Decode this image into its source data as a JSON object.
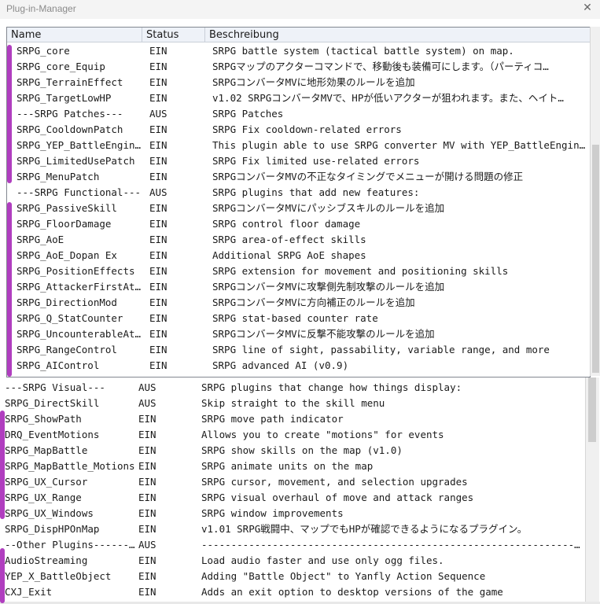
{
  "window": {
    "title": "Plug-in-Manager",
    "close_glyph": "✕"
  },
  "columns": {
    "name": "Name",
    "status": "Status",
    "description": "Beschreibung"
  },
  "accent_color": "#b03ebf",
  "rows_top": [
    {
      "name": "SRPG_core",
      "status": "EIN",
      "desc": "SRPG battle system (tactical battle system) on map."
    },
    {
      "name": "SRPG_core_Equip",
      "status": "EIN",
      "desc": "SRPGマップのアクターコマンドで、移動後も装備可にします。（パーティコ…"
    },
    {
      "name": "SRPG_TerrainEffect",
      "status": "EIN",
      "desc": "SRPGコンバータMVに地形効果のルールを追加"
    },
    {
      "name": "SRPG_TargetLowHP",
      "status": "EIN",
      "desc": "v1.02 SRPGコンバータMVで、HPが低いアクターが狙われます。また、ヘイト…"
    },
    {
      "name": "---SRPG Patches---",
      "status": "AUS",
      "desc": "SRPG Patches"
    },
    {
      "name": "SRPG_CooldownPatch",
      "status": "EIN",
      "desc": "SRPG Fix cooldown-related errors"
    },
    {
      "name": "SRPG_YEP_BattleEngine…",
      "status": "EIN",
      "desc": "This plugin able to use SRPG converter MV with YEP_BattleEngineCore.…"
    },
    {
      "name": "SRPG_LimitedUsePatch",
      "status": "EIN",
      "desc": "SRPG Fix limited use-related errors"
    },
    {
      "name": "SRPG_MenuPatch",
      "status": "EIN",
      "desc": "SRPGコンバータMVの不正なタイミングでメニューが開ける問題の修正"
    },
    {
      "name": "---SRPG Functional---",
      "status": "AUS",
      "desc": "SRPG plugins that add new features:"
    },
    {
      "name": "SRPG_PassiveSkill",
      "status": "EIN",
      "desc": "SRPGコンバータMVにパッシブスキルのルールを追加"
    },
    {
      "name": "SRPG_FloorDamage",
      "status": "EIN",
      "desc": "SRPG control floor damage"
    },
    {
      "name": "SRPG_AoE",
      "status": "EIN",
      "desc": "SRPG area-of-effect skills"
    },
    {
      "name": "SRPG_AoE_Dopan Ex",
      "status": "EIN",
      "desc": "Additional SRPG AoE shapes"
    },
    {
      "name": "SRPG_PositionEffects",
      "status": "EIN",
      "desc": "SRPG extension for movement and positioning skills"
    },
    {
      "name": "SRPG_AttackerFirstAtt…",
      "status": "EIN",
      "desc": "SRPGコンバータMVに攻撃側先制攻撃のルールを追加"
    },
    {
      "name": "SRPG_DirectionMod",
      "status": "EIN",
      "desc": "SRPGコンバータMVに方向補正のルールを追加"
    },
    {
      "name": "SRPG_Q_StatCounter",
      "status": "EIN",
      "desc": "SRPG stat-based counter rate"
    },
    {
      "name": "SRPG_UncounterableAtt…",
      "status": "EIN",
      "desc": "SRPGコンバータMVに反撃不能攻撃のルールを追加"
    },
    {
      "name": "SRPG_RangeControl",
      "status": "EIN",
      "desc": "SRPG line of sight, passability, variable range, and more"
    },
    {
      "name": "SRPG_AIControl",
      "status": "EIN",
      "desc": "SRPG advanced AI (v0.9)"
    }
  ],
  "rows_bottom": [
    {
      "name": "---SRPG Visual---",
      "status": "AUS",
      "desc": "SRPG plugins that change how things display:"
    },
    {
      "name": "SRPG_DirectSkill",
      "status": "AUS",
      "desc": "Skip straight to the skill menu"
    },
    {
      "name": "SRPG_ShowPath",
      "status": "EIN",
      "desc": "SRPG move path indicator"
    },
    {
      "name": "DRQ_EventMotions",
      "status": "EIN",
      "desc": "Allows you to create \"motions\" for events"
    },
    {
      "name": "SRPG_MapBattle",
      "status": "EIN",
      "desc": "SRPG show skills on the map (v1.0)"
    },
    {
      "name": "SRPG_MapBattle_Motions",
      "status": "EIN",
      "desc": "SRPG animate units on the map"
    },
    {
      "name": "SRPG_UX_Cursor",
      "status": "EIN",
      "desc": "SRPG cursor, movement, and selection upgrades"
    },
    {
      "name": "SRPG_UX_Range",
      "status": "EIN",
      "desc": "SRPG visual overhaul of move and attack ranges"
    },
    {
      "name": "SRPG_UX_Windows",
      "status": "EIN",
      "desc": "SRPG window improvements"
    },
    {
      "name": "SRPG_DispHPOnMap",
      "status": "EIN",
      "desc": "v1.01 SRPG戦闘中、マップでもHPが確認できるようになるプラグイン。"
    },
    {
      "name": "--Other Plugins--------",
      "status": "AUS",
      "desc": "------------------------------------------------------------------------------"
    },
    {
      "name": "AudioStreaming",
      "status": "EIN",
      "desc": "Load audio faster and use only ogg files."
    },
    {
      "name": "YEP_X_BattleObject",
      "status": "EIN",
      "desc": "Adding \"Battle Object\" to Yanfly Action Sequence"
    },
    {
      "name": "CXJ_Exit",
      "status": "EIN",
      "desc": "Adds an exit option to desktop versions of the game"
    }
  ]
}
